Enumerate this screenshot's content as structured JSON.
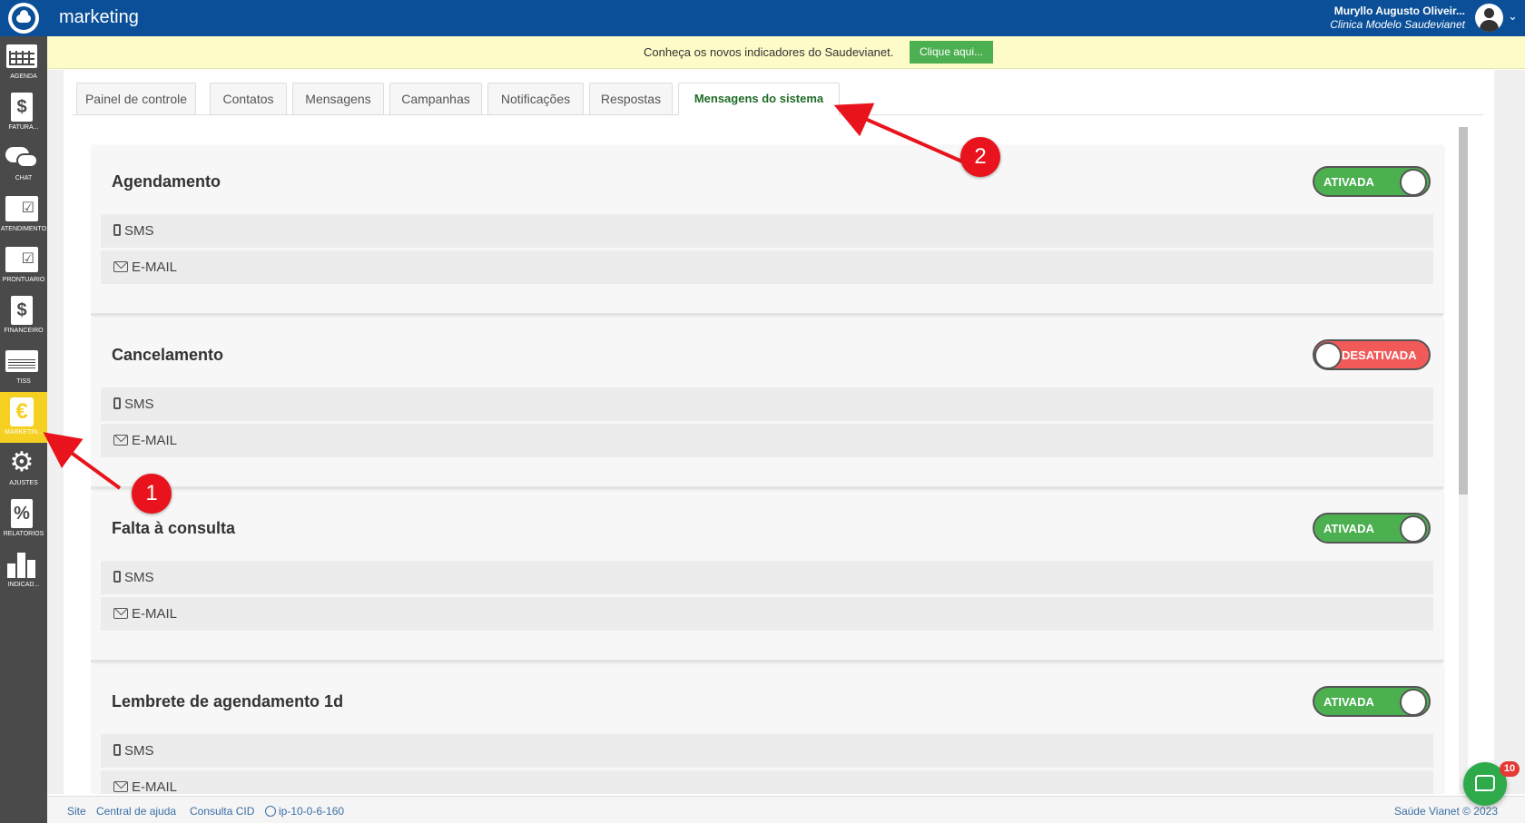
{
  "topbar": {
    "app_title": "marketing",
    "user_name": "Muryllo Augusto Oliveir...",
    "clinic_name": "Clinica Modelo Saudevianet",
    "logo_icon": "cloud-logo-icon",
    "colors": {
      "background": "#0a4f97"
    }
  },
  "sidebar": {
    "items": [
      {
        "label": "AGENDA",
        "icon": "calendar-icon"
      },
      {
        "label": "FATURA...",
        "icon": "invoice-icon"
      },
      {
        "label": "CHAT",
        "icon": "chat-icon"
      },
      {
        "label": "ATENDIMENTO",
        "icon": "attendance-folder-icon"
      },
      {
        "label": "PRONTUÁRIO",
        "icon": "records-folder-icon"
      },
      {
        "label": "FINANCEIRO",
        "icon": "financial-icon"
      },
      {
        "label": "TISS",
        "icon": "tiss-icon"
      },
      {
        "label": "MARKETIN...",
        "icon": "marketing-icon",
        "active": true
      },
      {
        "label": "AJUSTES",
        "icon": "gear-icon"
      },
      {
        "label": "RELATÓRIOS",
        "icon": "percent-report-icon"
      },
      {
        "label": "INDICAD...",
        "icon": "bar-chart-icon"
      }
    ],
    "colors": {
      "background": "#4a4a4a",
      "active": "#f5d020"
    }
  },
  "notice": {
    "text": "Conheça os novos indicadores do Saudevianet.",
    "button_label": "Clique aqui...",
    "close_symbol": "×"
  },
  "tabs": [
    {
      "label": "Painel de controle"
    },
    {
      "label": "Contatos"
    },
    {
      "label": "Mensagens"
    },
    {
      "label": "Campanhas"
    },
    {
      "label": "Notificações"
    },
    {
      "label": "Respostas"
    },
    {
      "label": "Mensagens do sistema",
      "active": true
    }
  ],
  "cards": [
    {
      "title": "Agendamento",
      "status": "ATIVADA",
      "enabled": true,
      "channels": [
        "SMS",
        "E-MAIL"
      ]
    },
    {
      "title": "Cancelamento",
      "status": "DESATIVADA",
      "enabled": false,
      "channels": [
        "SMS",
        "E-MAIL"
      ]
    },
    {
      "title": "Falta à consulta",
      "status": "ATIVADA",
      "enabled": true,
      "channels": [
        "SMS",
        "E-MAIL"
      ]
    },
    {
      "title": "Lembrete de agendamento 1d",
      "status": "ATIVADA",
      "enabled": true,
      "channels": [
        "SMS",
        "E-MAIL"
      ]
    }
  ],
  "footer": {
    "links": [
      "Site",
      "Central de ajuda",
      "Consulta CID"
    ],
    "host": "ip-10-0-6-160",
    "copyright": "Saúde Vianet © 2023"
  },
  "chat_widget": {
    "badge_count": "10"
  },
  "annotations": {
    "marker_1": "1",
    "marker_2": "2"
  },
  "colors": {
    "toggle_on": "#4caf50",
    "toggle_off": "#f25a5a",
    "active_tab_text": "#1f6b28",
    "annotation": "#e8131c"
  }
}
